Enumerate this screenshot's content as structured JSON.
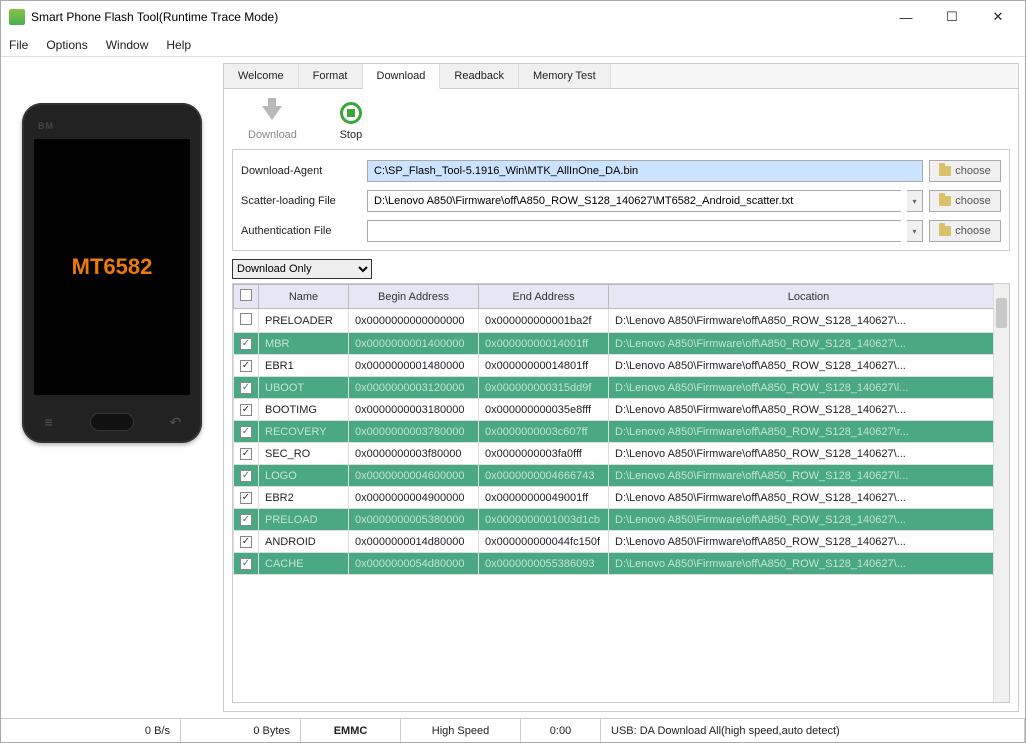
{
  "window": {
    "title": "Smart Phone Flash Tool(Runtime Trace Mode)"
  },
  "menu": [
    "File",
    "Options",
    "Window",
    "Help"
  ],
  "phone": {
    "brand": "BM",
    "chip": "MT6582"
  },
  "tabs": [
    "Welcome",
    "Format",
    "Download",
    "Readback",
    "Memory Test"
  ],
  "active_tab": "Download",
  "toolbar": {
    "download": "Download",
    "stop": "Stop"
  },
  "form": {
    "agent_label": "Download-Agent",
    "agent_value": "C:\\SP_Flash_Tool-5.1916_Win\\MTK_AllInOne_DA.bin",
    "scatter_label": "Scatter-loading File",
    "scatter_value": "D:\\Lenovo A850\\Firmware\\off\\A850_ROW_S128_140627\\MT6582_Android_scatter.txt",
    "auth_label": "Authentication File",
    "auth_value": "",
    "choose": "choose"
  },
  "mode": "Download Only",
  "columns": [
    "",
    "Name",
    "Begin Address",
    "End Address",
    "Location"
  ],
  "rows": [
    {
      "checked": false,
      "name": "PRELOADER",
      "begin": "0x0000000000000000",
      "end": "0x000000000001ba2f",
      "loc": "D:\\Lenovo A850\\Firmware\\off\\A850_ROW_S128_140627\\...",
      "green": false
    },
    {
      "checked": true,
      "name": "MBR",
      "begin": "0x0000000001400000",
      "end": "0x00000000014001ff",
      "loc": "D:\\Lenovo A850\\Firmware\\off\\A850_ROW_S128_140627\\...",
      "green": true
    },
    {
      "checked": true,
      "name": "EBR1",
      "begin": "0x0000000001480000",
      "end": "0x00000000014801ff",
      "loc": "D:\\Lenovo A850\\Firmware\\off\\A850_ROW_S128_140627\\...",
      "green": false
    },
    {
      "checked": true,
      "name": "UBOOT",
      "begin": "0x0000000003120000",
      "end": "0x000000000315dd9f",
      "loc": "D:\\Lenovo A850\\Firmware\\off\\A850_ROW_S128_140627\\l...",
      "green": true
    },
    {
      "checked": true,
      "name": "BOOTIMG",
      "begin": "0x0000000003180000",
      "end": "0x000000000035e8fff",
      "loc": "D:\\Lenovo A850\\Firmware\\off\\A850_ROW_S128_140627\\...",
      "green": false
    },
    {
      "checked": true,
      "name": "RECOVERY",
      "begin": "0x0000000003780000",
      "end": "0x0000000003c607ff",
      "loc": "D:\\Lenovo A850\\Firmware\\off\\A850_ROW_S128_140627\\r...",
      "green": true
    },
    {
      "checked": true,
      "name": "SEC_RO",
      "begin": "0x0000000003f80000",
      "end": "0x0000000003fa0fff",
      "loc": "D:\\Lenovo A850\\Firmware\\off\\A850_ROW_S128_140627\\...",
      "green": false
    },
    {
      "checked": true,
      "name": "LOGO",
      "begin": "0x0000000004600000",
      "end": "0x0000000004666743",
      "loc": "D:\\Lenovo A850\\Firmware\\off\\A850_ROW_S128_140627\\l...",
      "green": true
    },
    {
      "checked": true,
      "name": "EBR2",
      "begin": "0x0000000004900000",
      "end": "0x00000000049001ff",
      "loc": "D:\\Lenovo A850\\Firmware\\off\\A850_ROW_S128_140627\\...",
      "green": false
    },
    {
      "checked": true,
      "name": "PRELOAD",
      "begin": "0x0000000005380000",
      "end": "0x0000000001003d1cb",
      "loc": "D:\\Lenovo A850\\Firmware\\off\\A850_ROW_S128_140627\\...",
      "green": true
    },
    {
      "checked": true,
      "name": "ANDROID",
      "begin": "0x0000000014d80000",
      "end": "0x000000000044fc150f",
      "loc": "D:\\Lenovo A850\\Firmware\\off\\A850_ROW_S128_140627\\...",
      "green": false
    },
    {
      "checked": true,
      "name": "CACHE",
      "begin": "0x0000000054d80000",
      "end": "0x0000000055386093",
      "loc": "D:\\Lenovo A850\\Firmware\\off\\A850_ROW_S128_140627\\...",
      "green": true
    }
  ],
  "status": {
    "speed": "0 B/s",
    "bytes": "0 Bytes",
    "storage": "EMMC",
    "mode": "High Speed",
    "time": "0:00",
    "usb": "USB: DA Download All(high speed,auto detect)"
  }
}
